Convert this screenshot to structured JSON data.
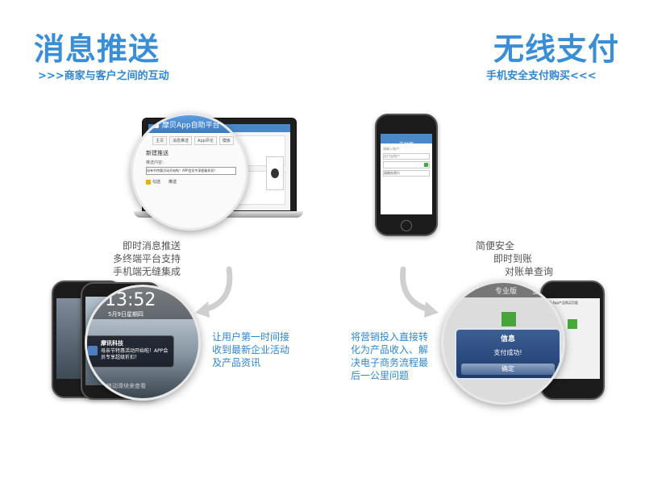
{
  "left": {
    "title": "消息推送",
    "subtitle": ">>>商家与客户之间的互动",
    "features": [
      "即时消息推送",
      "多终端平台支持",
      "手机端无缝集成"
    ],
    "description": [
      "让用户第一时间接",
      "收到最新企业活动",
      "及产品资讯"
    ],
    "laptop": {
      "app_title": "摩贝App自助平台",
      "tabs": [
        "主页",
        "消息推送",
        "App评论",
        "模板"
      ],
      "panel_title": "新建推送",
      "field_label": "推送内容：",
      "field_value": "母亲节特惠活动开始啦！APP会员专享超级折扣！",
      "check_label": "勾选",
      "submit": "推送"
    },
    "lock_screen": {
      "time": "13:52",
      "date": "5月9日星期四",
      "notif_app": "摩讯科技",
      "notif_text": "母亲节特惠活动开始啦！APP会员专享超级折扣！",
      "slider": "移动滑块来查看"
    }
  },
  "right": {
    "title": "无线支付",
    "subtitle": "手机安全支付购买<<<",
    "features": [
      "简便安全",
      "即时到账",
      "对账单查询"
    ],
    "description": [
      "将营销投入直接转",
      "化为产品收入、解",
      "决电子商务流程最",
      "后一公里问题"
    ],
    "pay_phone": {
      "header": "支付宝",
      "rows": [
        "请输入账户",
        "支付宝账户",
        "记住账号",
        "请输入密码"
      ],
      "tabs": [
        "专业版",
        "企业"
      ],
      "dialog_title": "信息",
      "dialog_text": "支付成功!",
      "dialog_button": "确定",
      "page_title": "Ali App产品购买页面"
    }
  },
  "colors": {
    "accent": "#3a8ed6",
    "grey_text": "#555555",
    "arrow": "#c8c8c8"
  }
}
